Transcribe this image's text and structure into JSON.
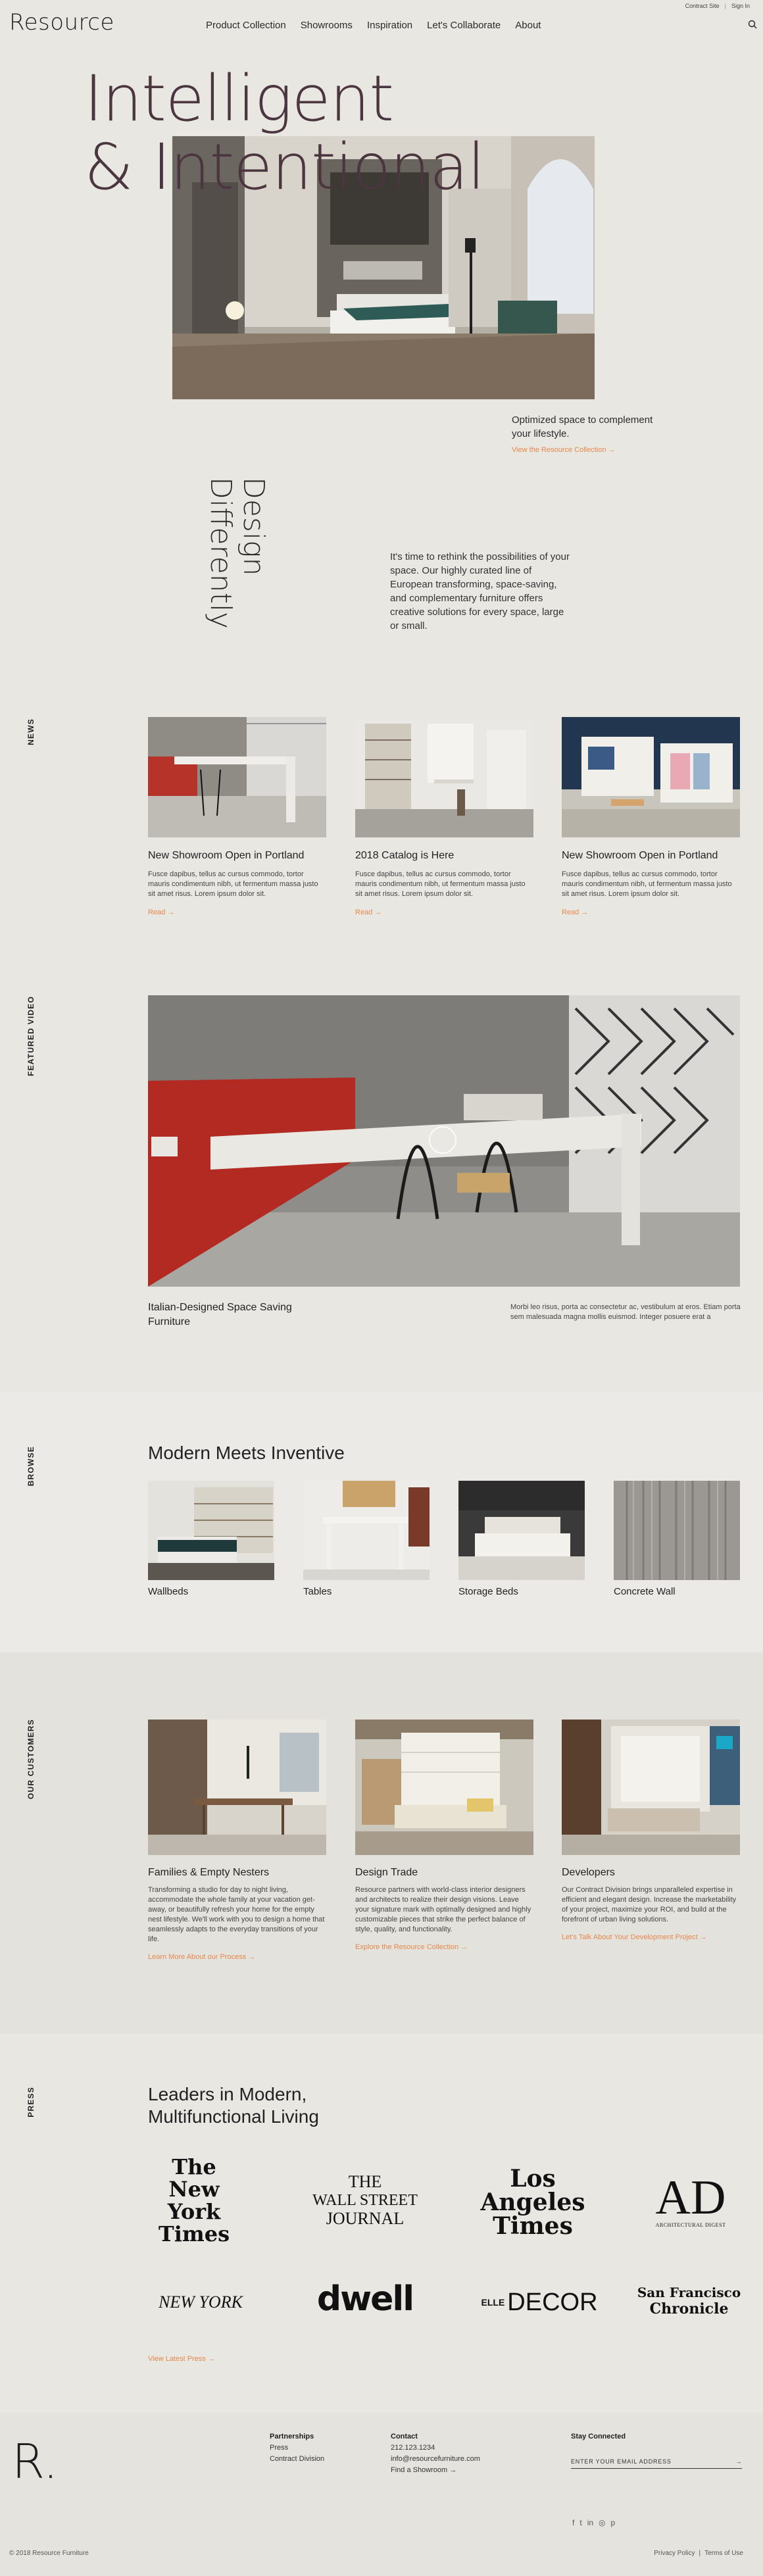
{
  "header": {
    "logo": "Resource",
    "util": {
      "contract": "Contract Site",
      "sep": "|",
      "signin": "Sign In"
    },
    "nav": [
      "Product Collection",
      "Showrooms",
      "Inspiration",
      "Let's Collaborate",
      "About"
    ]
  },
  "hero": {
    "title_line1": "Intelligent",
    "title_line2": "& Intentional",
    "subtitle": "Optimized space to complement your lifestyle.",
    "link": "View the Resource Collection  →"
  },
  "design": {
    "vertical_line1": "Design",
    "vertical_line2": "Differently",
    "copy": "It's time to rethink the possibilities of your space. Our highly curated line of European transforming, space-saving, and complementary furniture offers creative solutions for every space, large or small."
  },
  "news": {
    "label": "NEWS",
    "cards": [
      {
        "title": "New Showroom Open in Portland",
        "body": "Fusce dapibus, tellus ac cursus commodo, tortor mauris condimentum nibh, ut fermentum massa justo sit amet risus. Lorem ipsum dolor sit.",
        "read": "Read  →"
      },
      {
        "title": "2018 Catalog is Here",
        "body": "Fusce dapibus, tellus ac cursus commodo, tortor mauris condimentum nibh, ut fermentum massa justo sit amet risus. Lorem ipsum dolor sit.",
        "read": "Read  →"
      },
      {
        "title": "New Showroom Open in Portland",
        "body": "Fusce dapibus, tellus ac cursus commodo, tortor mauris condimentum nibh, ut fermentum massa justo sit amet risus. Lorem ipsum dolor sit.",
        "read": "Read  →"
      }
    ]
  },
  "video": {
    "label": "FEATURED VIDEO",
    "title": "Italian-Designed Space Saving Furniture",
    "desc": "Morbi leo risus, porta ac consectetur ac, vestibulum at eros. Etiam porta sem malesuada magna mollis euismod. Integer posuere erat a"
  },
  "browse": {
    "label": "BROWSE",
    "title": "Modern Meets Inventive",
    "items": [
      "Wallbeds",
      "Tables",
      "Storage Beds",
      "Concrete Wall"
    ]
  },
  "customers": {
    "label": "OUR CUSTOMERS",
    "cards": [
      {
        "title": "Families & Empty Nesters",
        "body": "Transforming a studio for day to night living, accommodate the whole family at your vacation get-away, or beautifully refresh your home for the empty nest lifestyle. We'll work with you to design a home that seamlessly adapts to the everyday transitions of your life.",
        "link": "Learn More About our Process  →"
      },
      {
        "title": "Design Trade",
        "body": "Resource partners with world-class interior designers and architects to realize their design visions. Leave your signature mark with optimally designed and highly customizable pieces that strike the perfect balance of style, quality, and functionality.",
        "link": "Explore the Resource Collection  →"
      },
      {
        "title": "Developers",
        "body": "Our Contract Division brings unparalleled expertise in efficient and elegant design. Increase the marketability of your project, maximize your ROI, and build at the forefront of urban living solutions.",
        "link": "Let's Talk About Your Development Project  →"
      }
    ]
  },
  "press": {
    "label": "PRESS",
    "title": "Leaders in Modern, Multifunctional Living",
    "logos": [
      {
        "name": "The New York Times",
        "line1": "The",
        "line2": "New York",
        "line3": "Times"
      },
      {
        "name": "The Wall Street Journal",
        "line1": "THE",
        "line2": "WALL STREET",
        "line3": "JOURNAL"
      },
      {
        "name": "Los Angeles Times",
        "line1": "Los",
        "line2": "Angeles",
        "line3": "Times"
      },
      {
        "name": "Architectural Digest",
        "line1": "AD",
        "line2": "ARCHITECTURAL DIGEST",
        "line3": ""
      },
      {
        "name": "New York",
        "line1": "NEW YORK",
        "line2": "",
        "line3": ""
      },
      {
        "name": "dwell",
        "line1": "dwell",
        "line2": "",
        "line3": ""
      },
      {
        "name": "Elle Decor",
        "line1": "ELLE",
        "line2": "DECOR",
        "line3": ""
      },
      {
        "name": "San Francisco Chronicle",
        "line1": "San Francisco",
        "line2": "Chronicle",
        "line3": ""
      }
    ],
    "link": "View Latest Press  →"
  },
  "footer": {
    "mark": "R.",
    "partnerships": {
      "heading": "Partnerships",
      "items": [
        "Press",
        "Contract Division"
      ]
    },
    "contact": {
      "heading": "Contact",
      "phone": "212.123.1234",
      "email": "info@resourcefurniture.com",
      "showrooms": "Find a Showroom  →"
    },
    "connected": {
      "heading": "Stay Connected",
      "placeholder": "ENTER YOUR EMAIL ADDRESS",
      "arrow": "→"
    },
    "social": [
      "f",
      "t",
      "in",
      "◎",
      "p"
    ],
    "copyright": "© 2018 Resource Furniture",
    "privacy": "Privacy Policy",
    "sep": "|",
    "terms": "Terms of Use"
  }
}
